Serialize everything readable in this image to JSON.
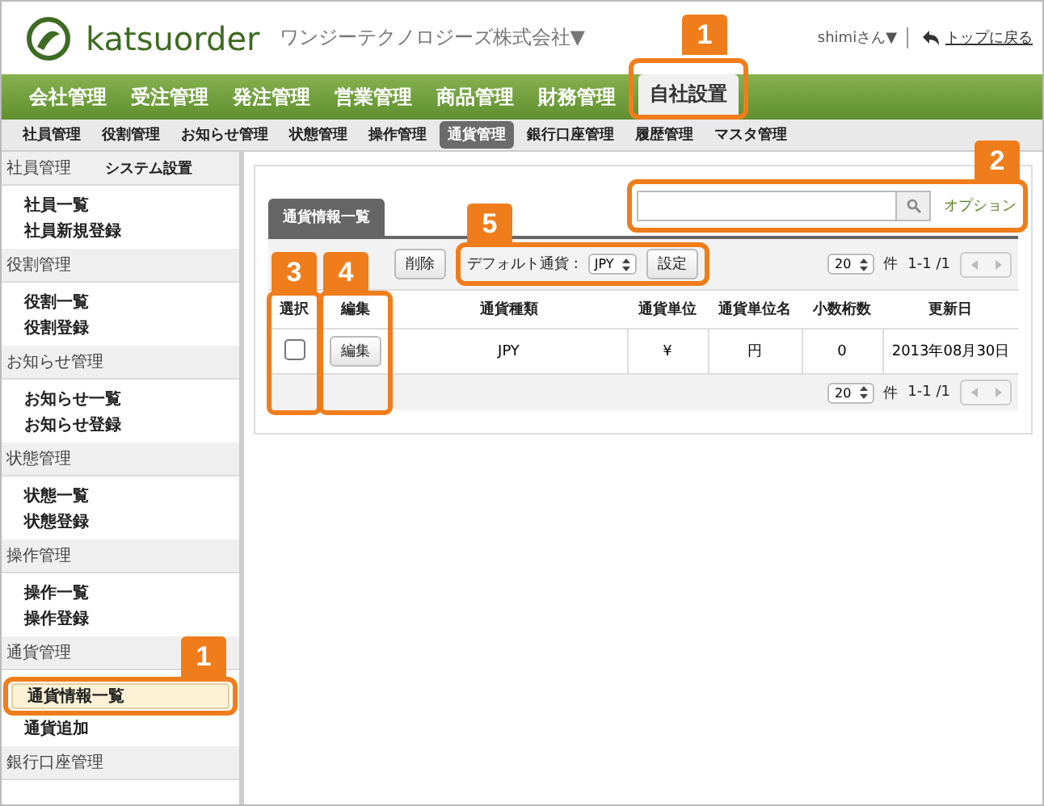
{
  "header": {
    "logo_text": "katsuorder",
    "company": "ワンジーテクノロジーズ株式会社▼",
    "user": "shimiさん▼",
    "top_link": "トップに戻る"
  },
  "main_nav": [
    {
      "label": "会社管理",
      "selected": false
    },
    {
      "label": "受注管理",
      "selected": false
    },
    {
      "label": "発注管理",
      "selected": false
    },
    {
      "label": "営業管理",
      "selected": false
    },
    {
      "label": "商品管理",
      "selected": false
    },
    {
      "label": "財務管理",
      "selected": false
    },
    {
      "label": "自社設置",
      "selected": true,
      "callout": "1"
    }
  ],
  "sub_nav": [
    {
      "label": "社員管理",
      "selected": false
    },
    {
      "label": "役割管理",
      "selected": false
    },
    {
      "label": "お知らせ管理",
      "selected": false
    },
    {
      "label": "状態管理",
      "selected": false
    },
    {
      "label": "操作管理",
      "selected": false
    },
    {
      "label": "通貨管理",
      "selected": true
    },
    {
      "label": "銀行口座管理",
      "selected": false
    },
    {
      "label": "履歴管理",
      "selected": false
    },
    {
      "label": "マスタ管理",
      "selected": false
    }
  ],
  "sidebar": {
    "title": "システム設置",
    "sections": [
      {
        "label": "社員管理",
        "items": [
          {
            "label": "社員一覧",
            "selected": false
          },
          {
            "label": "社員新規登録",
            "selected": false
          }
        ]
      },
      {
        "label": "役割管理",
        "items": [
          {
            "label": "役割一覧",
            "selected": false
          },
          {
            "label": "役割登録",
            "selected": false
          }
        ]
      },
      {
        "label": "お知らせ管理",
        "items": [
          {
            "label": "お知らせ一覧",
            "selected": false
          },
          {
            "label": "お知らせ登録",
            "selected": false
          }
        ]
      },
      {
        "label": "状態管理",
        "items": [
          {
            "label": "状態一覧",
            "selected": false
          },
          {
            "label": "状態登録",
            "selected": false
          }
        ]
      },
      {
        "label": "操作管理",
        "items": [
          {
            "label": "操作一覧",
            "selected": false
          },
          {
            "label": "操作登録",
            "selected": false
          }
        ]
      },
      {
        "label": "通貨管理",
        "items": [
          {
            "label": "通貨情報一覧",
            "selected": true,
            "callout": "1"
          },
          {
            "label": "通貨追加",
            "selected": false
          }
        ]
      },
      {
        "label": "銀行口座管理"
      }
    ]
  },
  "panel": {
    "tab": "通貨情報一覧",
    "search_callout": "2",
    "option_link": "オプション",
    "delete_button": "削除",
    "default_currency": {
      "callout": "5",
      "label": "デフォルト通貨 :",
      "value": "JPY",
      "button": "設定"
    },
    "pager_top": {
      "per_page": "20",
      "unit": "件",
      "range": "1-1 /1"
    },
    "columns": [
      {
        "label": "選択",
        "callout": "3"
      },
      {
        "label": "編集",
        "callout": "4"
      },
      {
        "label": "通貨種類"
      },
      {
        "label": "通貨単位"
      },
      {
        "label": "通貨単位名"
      },
      {
        "label": "小数桁数"
      },
      {
        "label": "更新日"
      }
    ],
    "rows": [
      {
        "cells": [
          {
            "kind": "checkbox",
            "checked": false
          },
          {
            "kind": "button",
            "text": "編集"
          },
          {
            "kind": "text",
            "text": "JPY"
          },
          {
            "kind": "text",
            "text": "¥"
          },
          {
            "kind": "text",
            "text": "円"
          },
          {
            "kind": "text",
            "text": "0"
          },
          {
            "kind": "text",
            "text": "2013年08月30日"
          }
        ]
      }
    ],
    "pager_bottom": {
      "per_page": "20",
      "unit": "件",
      "range": "1-1 /1"
    }
  }
}
